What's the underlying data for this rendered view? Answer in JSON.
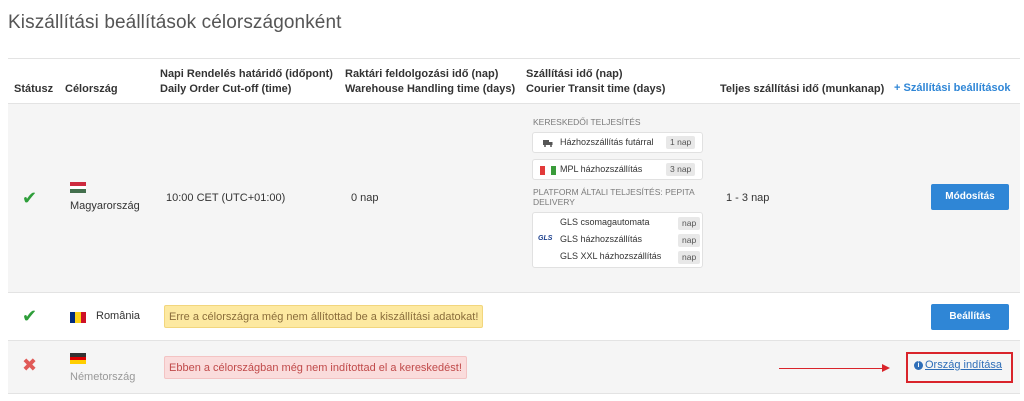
{
  "page": {
    "title": "Kiszállítási beállítások célországonként"
  },
  "headers": {
    "status": "Státusz",
    "country": "Célország",
    "cutoff_hu": "Napi Rendelés határidő (időpont)",
    "cutoff_en": "Daily Order Cut-off (time)",
    "handling_hu": "Raktári feldolgozási idő (nap)",
    "handling_en": "Warehouse Handling time (days)",
    "transit_hu": "Szállítási idő (nap)",
    "transit_en": "Courier Transit time (days)",
    "total": "Teljes szállítási idő (munkanap)",
    "add_link": "Szállítási beállítások",
    "add_icon": "+"
  },
  "rows": [
    {
      "country": "Magyarország",
      "status_icon": "check-icon",
      "cutoff": "10:00 CET (UTC+01:00)",
      "handling": "0 nap",
      "merchant_title": "Kereskedői teljesítés",
      "options": [
        {
          "label": "Házhozszállítás futárral",
          "tag": "1 nap",
          "icon": "truck-icon"
        },
        {
          "label": "MPL házhozszállítás",
          "tag": "3 nap",
          "icon": "mpl-logo-icon"
        }
      ],
      "platform_title": "Platform általi teljesítés: Pepita Delivery",
      "gls_logo": "GLS",
      "gls_options": [
        {
          "label": "GLS csomagautomata",
          "tag": "nap"
        },
        {
          "label": "GLS házhozszállítás",
          "tag": "nap"
        },
        {
          "label": "GLS XXL házhozszállítás",
          "tag": "nap"
        }
      ],
      "total": "1 - 3 nap",
      "action": "Módosítás"
    },
    {
      "country": "România",
      "status_icon": "check-icon",
      "message": "Erre a célországra még nem állítottad be a kiszállítási adatokat!",
      "action": "Beállítás"
    },
    {
      "country": "Németország",
      "status_icon": "cross-icon",
      "message": "Ebben a célországban még nem indítottad el a kereskedést!",
      "action": "Ország indítása",
      "info_icon": "i"
    }
  ],
  "colors": {
    "accent": "#2f86d6",
    "success": "#2e9e3a",
    "danger": "#e05a57",
    "highlight": "#d9242b",
    "warn_bg": "#fde9a1",
    "error_bg": "#fadcdc"
  },
  "status_glyphs": {
    "check": "✔",
    "cross": "✖"
  }
}
